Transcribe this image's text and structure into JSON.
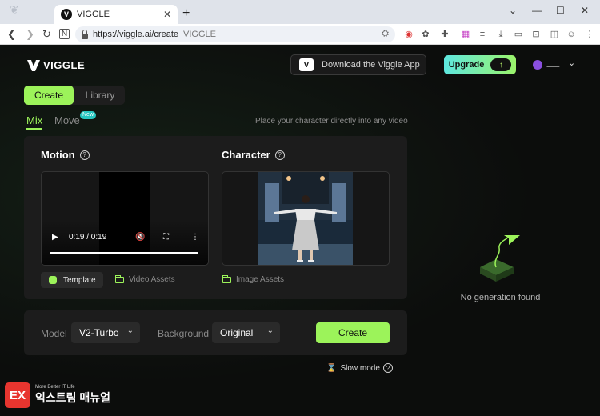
{
  "browser": {
    "tab_title": "VIGGLE",
    "tab_favicon": "V",
    "tab_close": "✕",
    "new_tab": "+",
    "url": "https://viggle.ai/create",
    "url_extra": "VIGGLE",
    "window_controls": [
      "⌄",
      "—",
      "☐",
      "✕"
    ]
  },
  "app": {
    "logo_text": "VIGGLE",
    "download_button": "Download the Viggle App",
    "download_icon": "V",
    "upgrade_button": "Upgrade",
    "user_name": "⸺",
    "mode_tabs": [
      "Create",
      "Library"
    ],
    "sub_tabs": {
      "mix": "Mix",
      "move": "Move",
      "new_badge": "New"
    },
    "hint": "Place your character directly into any video",
    "motion": {
      "title": "Motion",
      "time": "0:19 / 0:19",
      "template_button": "Template",
      "assets_link": "Video Assets"
    },
    "character": {
      "title": "Character",
      "assets_link": "Image Assets"
    },
    "settings": {
      "model_label": "Model",
      "model_value": "V2-Turbo",
      "background_label": "Background",
      "background_value": "Original",
      "create_button": "Create"
    },
    "slow_mode": "Slow mode",
    "empty_state": "No generation found"
  },
  "watermark": {
    "top": "More Better IT Life",
    "main": "익스트림 매뉴얼",
    "badge": "EX"
  },
  "colors": {
    "accent": "#9cf35a",
    "app_bg": "#0c0c0c",
    "panel_bg": "#1c1c1c"
  }
}
